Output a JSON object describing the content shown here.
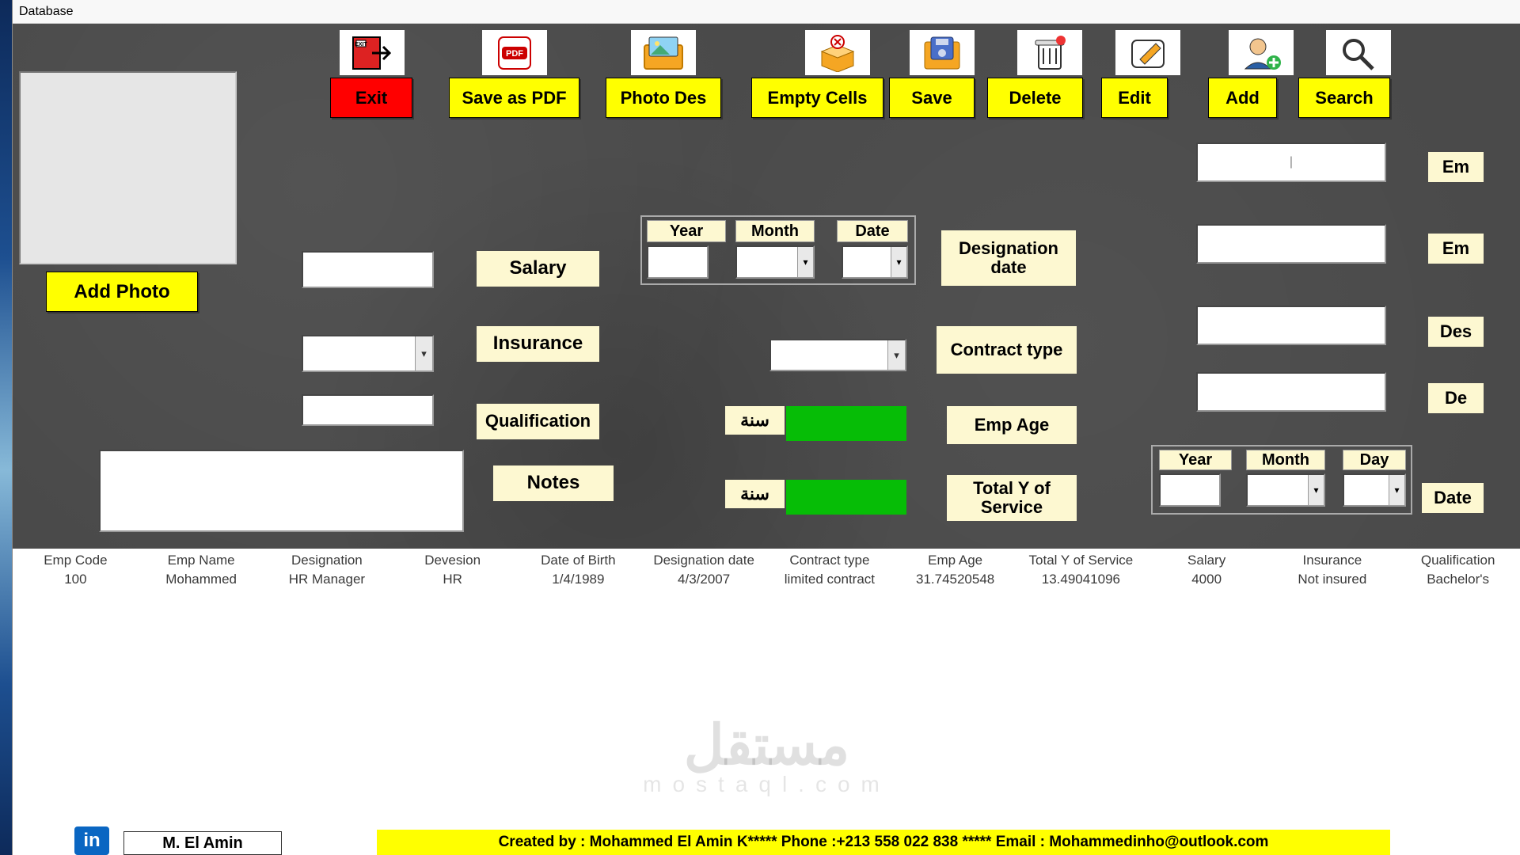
{
  "title": "Database",
  "toolbar": {
    "exit": "Exit",
    "save_pdf": "Save as PDF",
    "photo_des": "Photo Des",
    "empty_cells": "Empty Cells",
    "save": "Save",
    "delete": "Delete",
    "edit": "Edit",
    "add": "Add",
    "search": "Search"
  },
  "photo": {
    "add_label": "Add Photo"
  },
  "labels": {
    "salary": "Salary",
    "insurance": "Insurance",
    "qualification": "Qualification",
    "notes": "Notes",
    "designation_date": "Designation date",
    "contract_type": "Contract type",
    "emp_age": "Emp Age",
    "total_service": "Total Y of Service",
    "year": "Year",
    "month": "Month",
    "date": "Date",
    "day": "Day",
    "sane": "سنة",
    "date_of_birth": "Date of Birth",
    "Em": "Em",
    "Des": "Des",
    "De": "De",
    "DateL": "Date"
  },
  "grid": {
    "headers": [
      "Emp Code",
      "Emp Name",
      "Designation",
      "Devesion",
      "Date of Birth",
      "Designation date",
      "Contract type",
      "Emp Age",
      "Total Y of Service",
      "Salary",
      "Insurance",
      "Qualification"
    ],
    "row": [
      "100",
      "Mohammed",
      "HR Manager",
      "HR",
      "1/4/1989",
      "4/3/2007",
      "limited contract",
      "31.74520548",
      "13.49041096",
      "4000",
      "Not insured",
      "Bachelor's"
    ]
  },
  "watermark": {
    "main": "مستقل",
    "sub": "mostaql.com"
  },
  "footer": {
    "text": "Created by :  Mohammed El Amin K***** Phone :+213 558 022 838  ***** Email : Mohammedinho@outlook.com",
    "name": "M. El Amin",
    "in": "in"
  }
}
